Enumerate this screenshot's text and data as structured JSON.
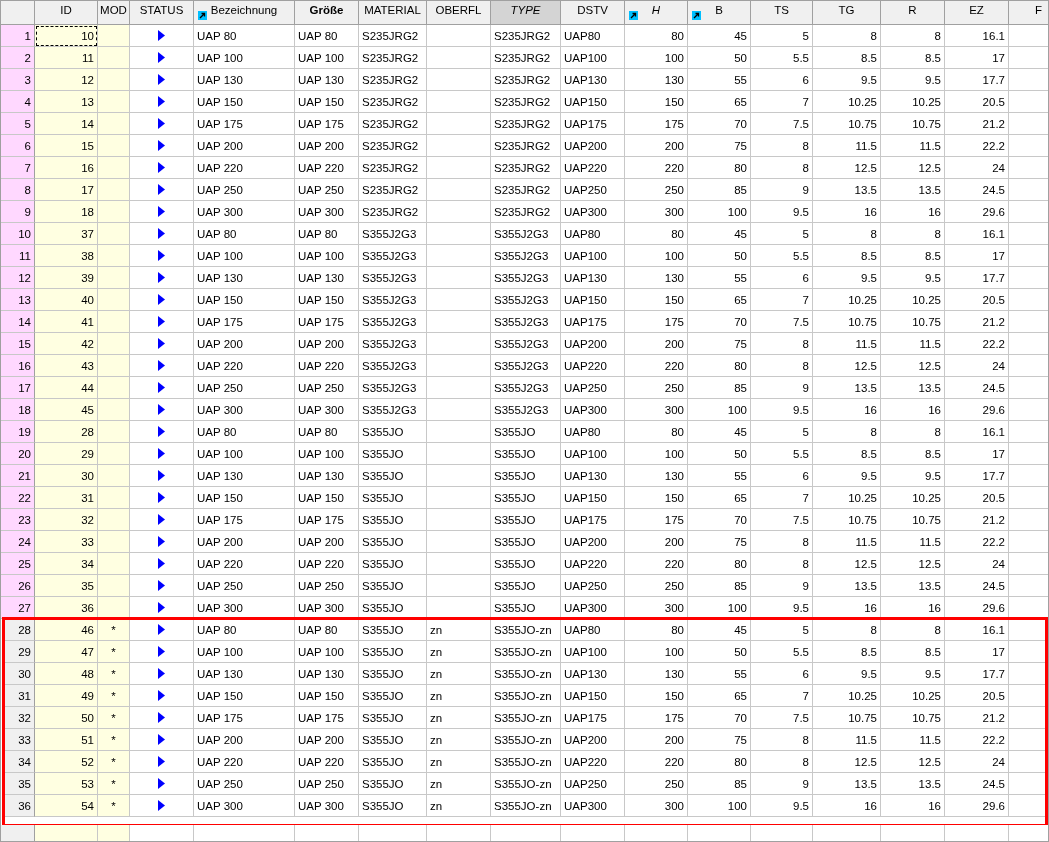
{
  "table": {
    "columns": [
      {
        "label": "ID",
        "kind": "number",
        "link_icon": false,
        "bold": false,
        "italic": false,
        "highlighted": false
      },
      {
        "label": "MOD",
        "kind": "mark",
        "link_icon": false,
        "bold": false,
        "italic": false,
        "highlighted": false
      },
      {
        "label": "STATUS",
        "kind": "status",
        "link_icon": false,
        "bold": false,
        "italic": false,
        "highlighted": false
      },
      {
        "label": "Bezeichnung",
        "kind": "text",
        "link_icon": true,
        "bold": false,
        "italic": false,
        "highlighted": false
      },
      {
        "label": "Größe",
        "kind": "text",
        "link_icon": false,
        "bold": true,
        "italic": false,
        "highlighted": false
      },
      {
        "label": "MATERIAL",
        "kind": "text",
        "link_icon": false,
        "bold": false,
        "italic": false,
        "highlighted": false
      },
      {
        "label": "OBERFL",
        "kind": "text",
        "link_icon": false,
        "bold": false,
        "italic": false,
        "highlighted": false
      },
      {
        "label": "TYPE",
        "kind": "text",
        "link_icon": false,
        "bold": false,
        "italic": true,
        "highlighted": true
      },
      {
        "label": "DSTV",
        "kind": "text",
        "link_icon": false,
        "bold": false,
        "italic": false,
        "highlighted": false
      },
      {
        "label": "H",
        "kind": "number",
        "link_icon": true,
        "bold": false,
        "italic": true,
        "highlighted": false
      },
      {
        "label": "B",
        "kind": "number",
        "link_icon": true,
        "bold": false,
        "italic": false,
        "highlighted": false
      },
      {
        "label": "TS",
        "kind": "number",
        "link_icon": false,
        "bold": false,
        "italic": false,
        "highlighted": false
      },
      {
        "label": "TG",
        "kind": "number",
        "link_icon": false,
        "bold": false,
        "italic": false,
        "highlighted": false
      },
      {
        "label": "R",
        "kind": "number",
        "link_icon": false,
        "bold": false,
        "italic": false,
        "highlighted": false
      },
      {
        "label": "EZ",
        "kind": "number",
        "link_icon": false,
        "bold": false,
        "italic": false,
        "highlighted": false
      },
      {
        "label": "F",
        "kind": "text",
        "link_icon": false,
        "bold": false,
        "italic": false,
        "highlighted": false
      }
    ],
    "row_groups": [
      {
        "outlined": false,
        "rows": [
          {
            "num": "1",
            "selected": true,
            "focused": true,
            "id": "10",
            "bez": "UAP 80",
            "gr": "UAP 80",
            "mat": "S235JRG2",
            "type": "S235JRG2",
            "dstv": "UAP80",
            "h": "80",
            "b": "45",
            "ts": "5",
            "tg": "8",
            "r": "8",
            "ez": "16.1"
          },
          {
            "num": "2",
            "selected": true,
            "focused": false,
            "id": "11",
            "bez": "UAP 100",
            "gr": "UAP 100",
            "mat": "S235JRG2",
            "type": "S235JRG2",
            "dstv": "UAP100",
            "h": "100",
            "b": "50",
            "ts": "5.5",
            "tg": "8.5",
            "r": "8.5",
            "ez": "17"
          },
          {
            "num": "3",
            "selected": true,
            "focused": false,
            "id": "12",
            "bez": "UAP 130",
            "gr": "UAP 130",
            "mat": "S235JRG2",
            "type": "S235JRG2",
            "dstv": "UAP130",
            "h": "130",
            "b": "55",
            "ts": "6",
            "tg": "9.5",
            "r": "9.5",
            "ez": "17.7"
          },
          {
            "num": "4",
            "selected": true,
            "focused": false,
            "id": "13",
            "bez": "UAP 150",
            "gr": "UAP 150",
            "mat": "S235JRG2",
            "type": "S235JRG2",
            "dstv": "UAP150",
            "h": "150",
            "b": "65",
            "ts": "7",
            "tg": "10.25",
            "r": "10.25",
            "ez": "20.5"
          },
          {
            "num": "5",
            "selected": true,
            "focused": false,
            "id": "14",
            "bez": "UAP 175",
            "gr": "UAP 175",
            "mat": "S235JRG2",
            "type": "S235JRG2",
            "dstv": "UAP175",
            "h": "175",
            "b": "70",
            "ts": "7.5",
            "tg": "10.75",
            "r": "10.75",
            "ez": "21.2"
          },
          {
            "num": "6",
            "selected": true,
            "focused": false,
            "id": "15",
            "bez": "UAP 200",
            "gr": "UAP 200",
            "mat": "S235JRG2",
            "type": "S235JRG2",
            "dstv": "UAP200",
            "h": "200",
            "b": "75",
            "ts": "8",
            "tg": "11.5",
            "r": "11.5",
            "ez": "22.2"
          },
          {
            "num": "7",
            "selected": true,
            "focused": false,
            "id": "16",
            "bez": "UAP 220",
            "gr": "UAP 220",
            "mat": "S235JRG2",
            "type": "S235JRG2",
            "dstv": "UAP220",
            "h": "220",
            "b": "80",
            "ts": "8",
            "tg": "12.5",
            "r": "12.5",
            "ez": "24"
          },
          {
            "num": "8",
            "selected": true,
            "focused": false,
            "id": "17",
            "bez": "UAP 250",
            "gr": "UAP 250",
            "mat": "S235JRG2",
            "type": "S235JRG2",
            "dstv": "UAP250",
            "h": "250",
            "b": "85",
            "ts": "9",
            "tg": "13.5",
            "r": "13.5",
            "ez": "24.5"
          },
          {
            "num": "9",
            "selected": true,
            "focused": false,
            "id": "18",
            "bez": "UAP 300",
            "gr": "UAP 300",
            "mat": "S235JRG2",
            "type": "S235JRG2",
            "dstv": "UAP300",
            "h": "300",
            "b": "100",
            "ts": "9.5",
            "tg": "16",
            "r": "16",
            "ez": "29.6"
          },
          {
            "num": "10",
            "selected": true,
            "focused": false,
            "id": "37",
            "bez": "UAP 80",
            "gr": "UAP 80",
            "mat": "S355J2G3",
            "type": "S355J2G3",
            "dstv": "UAP80",
            "h": "80",
            "b": "45",
            "ts": "5",
            "tg": "8",
            "r": "8",
            "ez": "16.1"
          },
          {
            "num": "11",
            "selected": true,
            "focused": false,
            "id": "38",
            "bez": "UAP 100",
            "gr": "UAP 100",
            "mat": "S355J2G3",
            "type": "S355J2G3",
            "dstv": "UAP100",
            "h": "100",
            "b": "50",
            "ts": "5.5",
            "tg": "8.5",
            "r": "8.5",
            "ez": "17"
          },
          {
            "num": "12",
            "selected": true,
            "focused": false,
            "id": "39",
            "bez": "UAP 130",
            "gr": "UAP 130",
            "mat": "S355J2G3",
            "type": "S355J2G3",
            "dstv": "UAP130",
            "h": "130",
            "b": "55",
            "ts": "6",
            "tg": "9.5",
            "r": "9.5",
            "ez": "17.7"
          },
          {
            "num": "13",
            "selected": true,
            "focused": false,
            "id": "40",
            "bez": "UAP 150",
            "gr": "UAP 150",
            "mat": "S355J2G3",
            "type": "S355J2G3",
            "dstv": "UAP150",
            "h": "150",
            "b": "65",
            "ts": "7",
            "tg": "10.25",
            "r": "10.25",
            "ez": "20.5"
          },
          {
            "num": "14",
            "selected": true,
            "focused": false,
            "id": "41",
            "bez": "UAP 175",
            "gr": "UAP 175",
            "mat": "S355J2G3",
            "type": "S355J2G3",
            "dstv": "UAP175",
            "h": "175",
            "b": "70",
            "ts": "7.5",
            "tg": "10.75",
            "r": "10.75",
            "ez": "21.2"
          },
          {
            "num": "15",
            "selected": true,
            "focused": false,
            "id": "42",
            "bez": "UAP 200",
            "gr": "UAP 200",
            "mat": "S355J2G3",
            "type": "S355J2G3",
            "dstv": "UAP200",
            "h": "200",
            "b": "75",
            "ts": "8",
            "tg": "11.5",
            "r": "11.5",
            "ez": "22.2"
          },
          {
            "num": "16",
            "selected": true,
            "focused": false,
            "id": "43",
            "bez": "UAP 220",
            "gr": "UAP 220",
            "mat": "S355J2G3",
            "type": "S355J2G3",
            "dstv": "UAP220",
            "h": "220",
            "b": "80",
            "ts": "8",
            "tg": "12.5",
            "r": "12.5",
            "ez": "24"
          },
          {
            "num": "17",
            "selected": true,
            "focused": false,
            "id": "44",
            "bez": "UAP 250",
            "gr": "UAP 250",
            "mat": "S355J2G3",
            "type": "S355J2G3",
            "dstv": "UAP250",
            "h": "250",
            "b": "85",
            "ts": "9",
            "tg": "13.5",
            "r": "13.5",
            "ez": "24.5"
          },
          {
            "num": "18",
            "selected": true,
            "focused": false,
            "id": "45",
            "bez": "UAP 300",
            "gr": "UAP 300",
            "mat": "S355J2G3",
            "type": "S355J2G3",
            "dstv": "UAP300",
            "h": "300",
            "b": "100",
            "ts": "9.5",
            "tg": "16",
            "r": "16",
            "ez": "29.6"
          },
          {
            "num": "19",
            "selected": true,
            "focused": false,
            "id": "28",
            "bez": "UAP 80",
            "gr": "UAP 80",
            "mat": "S355JO",
            "type": "S355JO",
            "dstv": "UAP80",
            "h": "80",
            "b": "45",
            "ts": "5",
            "tg": "8",
            "r": "8",
            "ez": "16.1"
          },
          {
            "num": "20",
            "selected": true,
            "focused": false,
            "id": "29",
            "bez": "UAP 100",
            "gr": "UAP 100",
            "mat": "S355JO",
            "type": "S355JO",
            "dstv": "UAP100",
            "h": "100",
            "b": "50",
            "ts": "5.5",
            "tg": "8.5",
            "r": "8.5",
            "ez": "17"
          },
          {
            "num": "21",
            "selected": true,
            "focused": false,
            "id": "30",
            "bez": "UAP 130",
            "gr": "UAP 130",
            "mat": "S355JO",
            "type": "S355JO",
            "dstv": "UAP130",
            "h": "130",
            "b": "55",
            "ts": "6",
            "tg": "9.5",
            "r": "9.5",
            "ez": "17.7"
          },
          {
            "num": "22",
            "selected": true,
            "focused": false,
            "id": "31",
            "bez": "UAP 150",
            "gr": "UAP 150",
            "mat": "S355JO",
            "type": "S355JO",
            "dstv": "UAP150",
            "h": "150",
            "b": "65",
            "ts": "7",
            "tg": "10.25",
            "r": "10.25",
            "ez": "20.5"
          },
          {
            "num": "23",
            "selected": true,
            "focused": false,
            "id": "32",
            "bez": "UAP 175",
            "gr": "UAP 175",
            "mat": "S355JO",
            "type": "S355JO",
            "dstv": "UAP175",
            "h": "175",
            "b": "70",
            "ts": "7.5",
            "tg": "10.75",
            "r": "10.75",
            "ez": "21.2"
          },
          {
            "num": "24",
            "selected": true,
            "focused": false,
            "id": "33",
            "bez": "UAP 200",
            "gr": "UAP 200",
            "mat": "S355JO",
            "type": "S355JO",
            "dstv": "UAP200",
            "h": "200",
            "b": "75",
            "ts": "8",
            "tg": "11.5",
            "r": "11.5",
            "ez": "22.2"
          },
          {
            "num": "25",
            "selected": true,
            "focused": false,
            "id": "34",
            "bez": "UAP 220",
            "gr": "UAP 220",
            "mat": "S355JO",
            "type": "S355JO",
            "dstv": "UAP220",
            "h": "220",
            "b": "80",
            "ts": "8",
            "tg": "12.5",
            "r": "12.5",
            "ez": "24"
          },
          {
            "num": "26",
            "selected": true,
            "focused": false,
            "id": "35",
            "bez": "UAP 250",
            "gr": "UAP 250",
            "mat": "S355JO",
            "type": "S355JO",
            "dstv": "UAP250",
            "h": "250",
            "b": "85",
            "ts": "9",
            "tg": "13.5",
            "r": "13.5",
            "ez": "24.5"
          },
          {
            "num": "27",
            "selected": true,
            "focused": false,
            "id": "36",
            "bez": "UAP 300",
            "gr": "UAP 300",
            "mat": "S355JO",
            "type": "S355JO",
            "dstv": "UAP300",
            "h": "300",
            "b": "100",
            "ts": "9.5",
            "tg": "16",
            "r": "16",
            "ez": "29.6"
          }
        ]
      },
      {
        "outlined": true,
        "rows": [
          {
            "num": "28",
            "selected": false,
            "focused": false,
            "id": "46",
            "mod": "*",
            "bez": "UAP 80",
            "gr": "UAP 80",
            "mat": "S355JO",
            "oberfl": "zn",
            "type": "S355JO-zn",
            "dstv": "UAP80",
            "h": "80",
            "b": "45",
            "ts": "5",
            "tg": "8",
            "r": "8",
            "ez": "16.1"
          },
          {
            "num": "29",
            "selected": false,
            "focused": false,
            "id": "47",
            "mod": "*",
            "bez": "UAP 100",
            "gr": "UAP 100",
            "mat": "S355JO",
            "oberfl": "zn",
            "type": "S355JO-zn",
            "dstv": "UAP100",
            "h": "100",
            "b": "50",
            "ts": "5.5",
            "tg": "8.5",
            "r": "8.5",
            "ez": "17"
          },
          {
            "num": "30",
            "selected": false,
            "focused": false,
            "id": "48",
            "mod": "*",
            "bez": "UAP 130",
            "gr": "UAP 130",
            "mat": "S355JO",
            "oberfl": "zn",
            "type": "S355JO-zn",
            "dstv": "UAP130",
            "h": "130",
            "b": "55",
            "ts": "6",
            "tg": "9.5",
            "r": "9.5",
            "ez": "17.7"
          },
          {
            "num": "31",
            "selected": false,
            "focused": false,
            "id": "49",
            "mod": "*",
            "bez": "UAP 150",
            "gr": "UAP 150",
            "mat": "S355JO",
            "oberfl": "zn",
            "type": "S355JO-zn",
            "dstv": "UAP150",
            "h": "150",
            "b": "65",
            "ts": "7",
            "tg": "10.25",
            "r": "10.25",
            "ez": "20.5"
          },
          {
            "num": "32",
            "selected": false,
            "focused": false,
            "id": "50",
            "mod": "*",
            "bez": "UAP 175",
            "gr": "UAP 175",
            "mat": "S355JO",
            "oberfl": "zn",
            "type": "S355JO-zn",
            "dstv": "UAP175",
            "h": "175",
            "b": "70",
            "ts": "7.5",
            "tg": "10.75",
            "r": "10.75",
            "ez": "21.2"
          },
          {
            "num": "33",
            "selected": false,
            "focused": false,
            "id": "51",
            "mod": "*",
            "bez": "UAP 200",
            "gr": "UAP 200",
            "mat": "S355JO",
            "oberfl": "zn",
            "type": "S355JO-zn",
            "dstv": "UAP200",
            "h": "200",
            "b": "75",
            "ts": "8",
            "tg": "11.5",
            "r": "11.5",
            "ez": "22.2"
          },
          {
            "num": "34",
            "selected": false,
            "focused": false,
            "id": "52",
            "mod": "*",
            "bez": "UAP 220",
            "gr": "UAP 220",
            "mat": "S355JO",
            "oberfl": "zn",
            "type": "S355JO-zn",
            "dstv": "UAP220",
            "h": "220",
            "b": "80",
            "ts": "8",
            "tg": "12.5",
            "r": "12.5",
            "ez": "24"
          },
          {
            "num": "35",
            "selected": false,
            "focused": false,
            "id": "53",
            "mod": "*",
            "bez": "UAP 250",
            "gr": "UAP 250",
            "mat": "S355JO",
            "oberfl": "zn",
            "type": "S355JO-zn",
            "dstv": "UAP250",
            "h": "250",
            "b": "85",
            "ts": "9",
            "tg": "13.5",
            "r": "13.5",
            "ez": "24.5"
          },
          {
            "num": "36",
            "selected": false,
            "focused": false,
            "id": "54",
            "mod": "*",
            "bez": "UAP 300",
            "gr": "UAP 300",
            "mat": "S355JO",
            "oberfl": "zn",
            "type": "S355JO-zn",
            "dstv": "UAP300",
            "h": "300",
            "b": "100",
            "ts": "9.5",
            "tg": "16",
            "r": "16",
            "ez": "29.6"
          }
        ]
      }
    ]
  }
}
